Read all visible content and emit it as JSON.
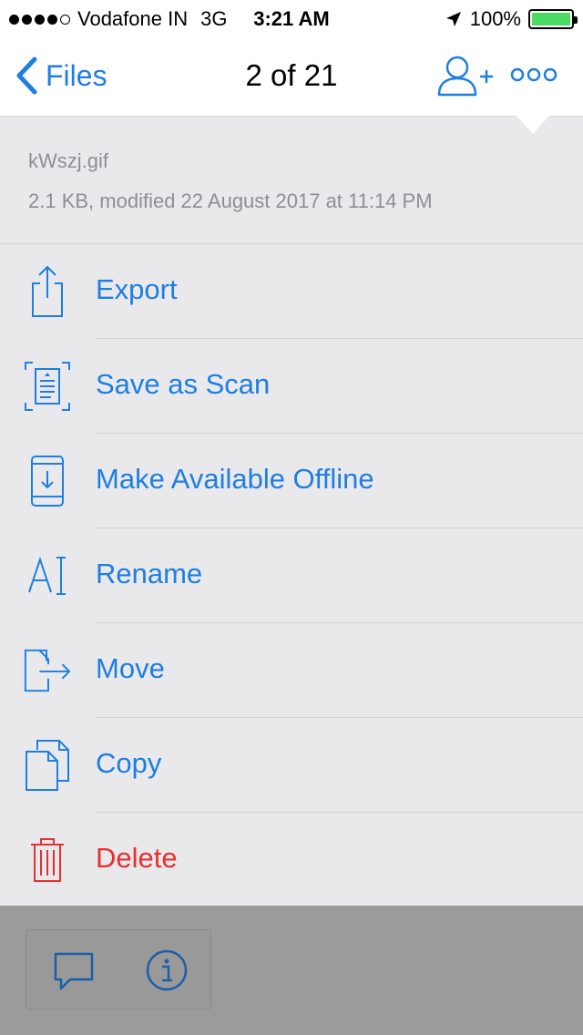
{
  "status_bar": {
    "carrier": "Vodafone IN",
    "network": "3G",
    "time": "3:21 AM",
    "battery": "100%",
    "battery_color": "#4cd964"
  },
  "nav": {
    "back_label": "Files",
    "title": "2 of 21",
    "share_icon": "add-person-icon",
    "more_icon": "more-dots-icon"
  },
  "file": {
    "name": "kWszj.gif",
    "meta": "2.1 KB, modified 22 August 2017 at 11:14 PM"
  },
  "menu": {
    "items": [
      {
        "label": "Export",
        "icon": "export-icon"
      },
      {
        "label": "Save as Scan",
        "icon": "scan-icon"
      },
      {
        "label": "Make Available Offline",
        "icon": "offline-device-icon"
      },
      {
        "label": "Rename",
        "icon": "rename-icon"
      },
      {
        "label": "Move",
        "icon": "move-icon"
      },
      {
        "label": "Copy",
        "icon": "copy-icon"
      },
      {
        "label": "Delete",
        "icon": "trash-icon"
      }
    ]
  },
  "toolbar": {
    "comment_icon": "comment-icon",
    "info_icon": "info-icon"
  },
  "colors": {
    "accent": "#1e7fe0",
    "danger": "#e53030",
    "sheet": "#e9e9ec"
  }
}
